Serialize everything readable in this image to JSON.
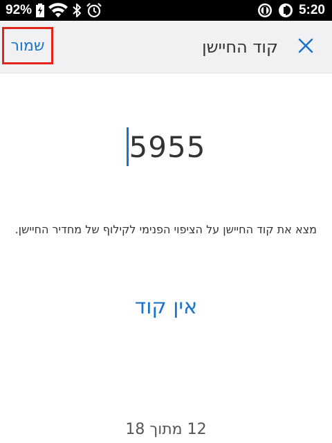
{
  "status_bar": {
    "battery_percent": "92%",
    "time": "5:20",
    "icons": [
      "battery-charging-icon",
      "wifi-icon",
      "bluetooth-icon",
      "alarm-icon",
      "vpn-icon",
      "data-saver-icon"
    ]
  },
  "app_bar": {
    "save_label": "שמור",
    "title": "קוד החיישן",
    "close_icon": "close-icon"
  },
  "code": {
    "value": "5955"
  },
  "instruction": "מצא את קוד החיישן על הציפוי הפנימי לקילוף של מחדיר החיישן.",
  "no_code_label": "אין קוד",
  "pager": "12 מתוך 18",
  "colors": {
    "accent": "#1a73c8",
    "highlight_border": "#e2231a",
    "app_bar_bg": "#f1f1f3",
    "status_bar_bg": "#000000"
  }
}
